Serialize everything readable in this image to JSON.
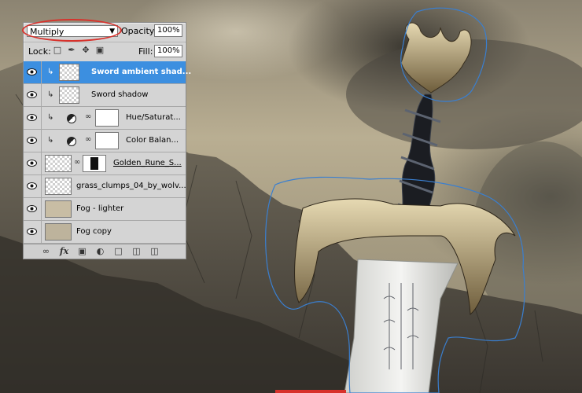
{
  "panel": {
    "blend_mode": "Multiply",
    "opacity_label": "Opacity:",
    "opacity_value": "100%",
    "lock_label": "Lock:",
    "fill_label": "Fill:",
    "fill_value": "100%",
    "annotation_color": "#d8312b",
    "selection_color": "#3c8fe0"
  },
  "layers": [
    {
      "name": "Sword ambient shad...",
      "selected": true
    },
    {
      "name": "Sword shadow"
    },
    {
      "name": "Hue/Saturat..."
    },
    {
      "name": "Color Balan..."
    },
    {
      "name": "Golden_Rune_S..."
    },
    {
      "name": "grass_clumps_04_by_wolv..."
    },
    {
      "name": "Fog - lighter"
    },
    {
      "name": "Fog copy"
    }
  ],
  "icons": {
    "lock": [
      "lock-transparent-icon",
      "lock-image-icon",
      "lock-position-icon",
      "lock-all-icon"
    ],
    "footer": [
      "link-layers-icon",
      "fx-icon",
      "add-mask-icon",
      "adjustment-layer-icon",
      "group-folder-icon",
      "new-layer-icon",
      "trash-icon"
    ]
  },
  "scene": {
    "selection_outline_color": "#3a7fd0"
  }
}
